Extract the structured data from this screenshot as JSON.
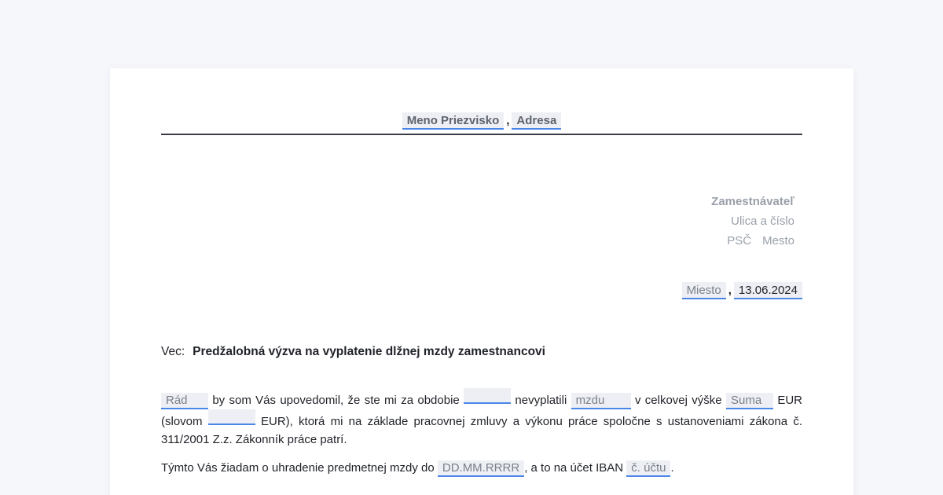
{
  "header": {
    "name_placeholder": "Meno Priezvisko",
    "separator": ",",
    "address_placeholder": "Adresa"
  },
  "recipient": {
    "name": "Zamestnávateľ",
    "street": "Ulica a číslo",
    "postal_code": "PSČ",
    "city": "Mesto"
  },
  "date_line": {
    "place_placeholder": "Miesto",
    "separator": ",",
    "date_value": "13.06.2024"
  },
  "subject": {
    "label": "Vec:",
    "title": "Predžalobná výzva na vyplatenie dlžnej mzdy zamestnancovi"
  },
  "paragraph1": {
    "field_salutation": "Rád",
    "text_a": "by som Vás upovedomil, že ste mi za obdobie",
    "field_period": "",
    "text_b": "nevyplatili",
    "field_wage_type": "mzdu",
    "text_c": "v celkovej výške",
    "field_amount": "Suma",
    "text_d": "EUR (slovom",
    "field_amount_words": "",
    "text_e": "EUR), ktorá mi na základe pracovnej zmluvy a výkonu práce spoločne s ustanoveniami zákona č. 311/2001 Z.z. Zákonník práce patrí."
  },
  "paragraph2": {
    "text_a": "Týmto Vás žiadam o uhradenie predmetnej mzdy do",
    "field_due_date": "DD.MM.RRRR",
    "text_b": ", a to na účet IBAN",
    "field_iban": "č. účtu",
    "text_c": "."
  },
  "colors": {
    "field_underline": "#4a86e8",
    "field_background": "#edeff4",
    "placeholder_text": "#7b808a",
    "page_background": "#f6f7fb"
  }
}
